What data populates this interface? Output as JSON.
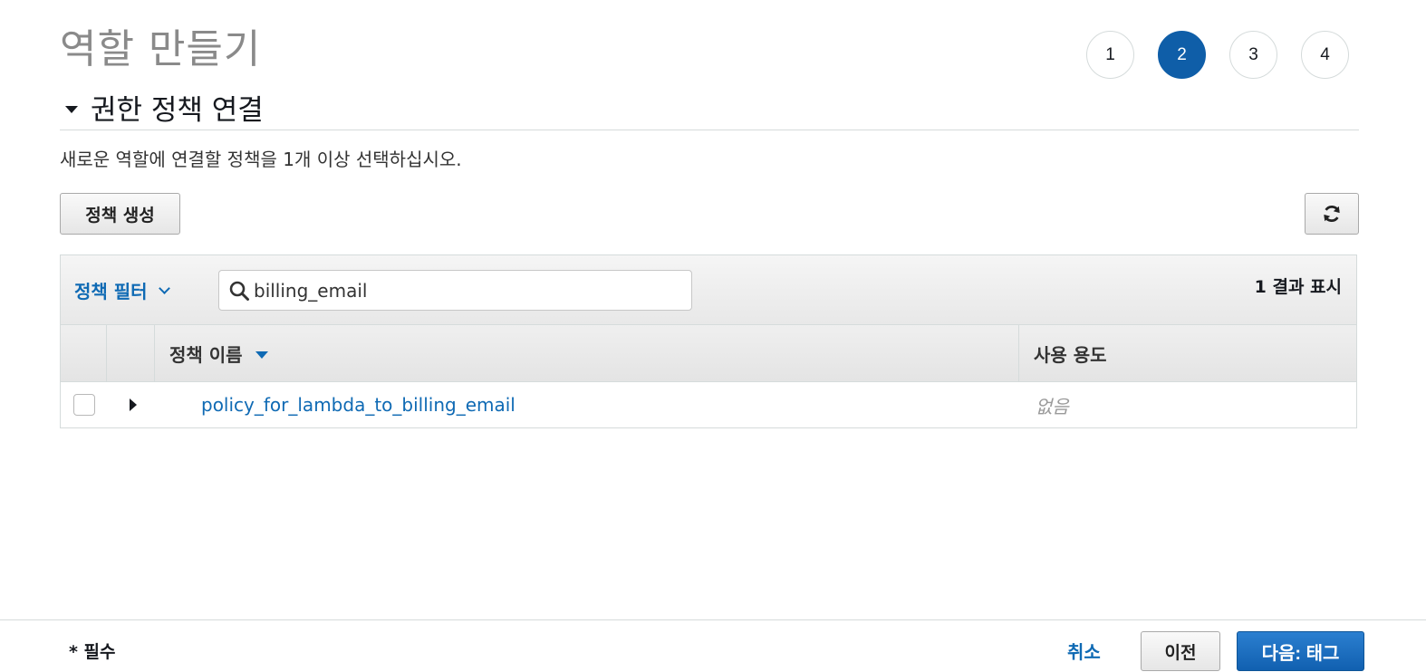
{
  "header": {
    "title": "역할 만들기",
    "steps": [
      "1",
      "2",
      "3",
      "4"
    ],
    "active_step": "2"
  },
  "section": {
    "title": "권한 정책 연결",
    "description": "새로운 역할에 연결할 정책을 1개 이상 선택하십시오."
  },
  "toolbar": {
    "create_policy_label": "정책 생성",
    "refresh_icon": "refresh-icon"
  },
  "filter": {
    "dropdown_label": "정책 필터",
    "search_value": "billing_email",
    "result_count": "1 결과 표시"
  },
  "table": {
    "columns": [
      "정책 이름",
      "사용 용도"
    ],
    "rows": [
      {
        "name": "policy_for_lambda_to_billing_email",
        "usage": "없음",
        "checked": false
      }
    ]
  },
  "footer": {
    "required_note": "* 필수",
    "cancel_label": "취소",
    "prev_label": "이전",
    "next_label": "다음: 태그"
  },
  "colors": {
    "accent": "#0f5ea8",
    "link": "#0f6ab4",
    "primary_button": "#1a6fc2"
  }
}
